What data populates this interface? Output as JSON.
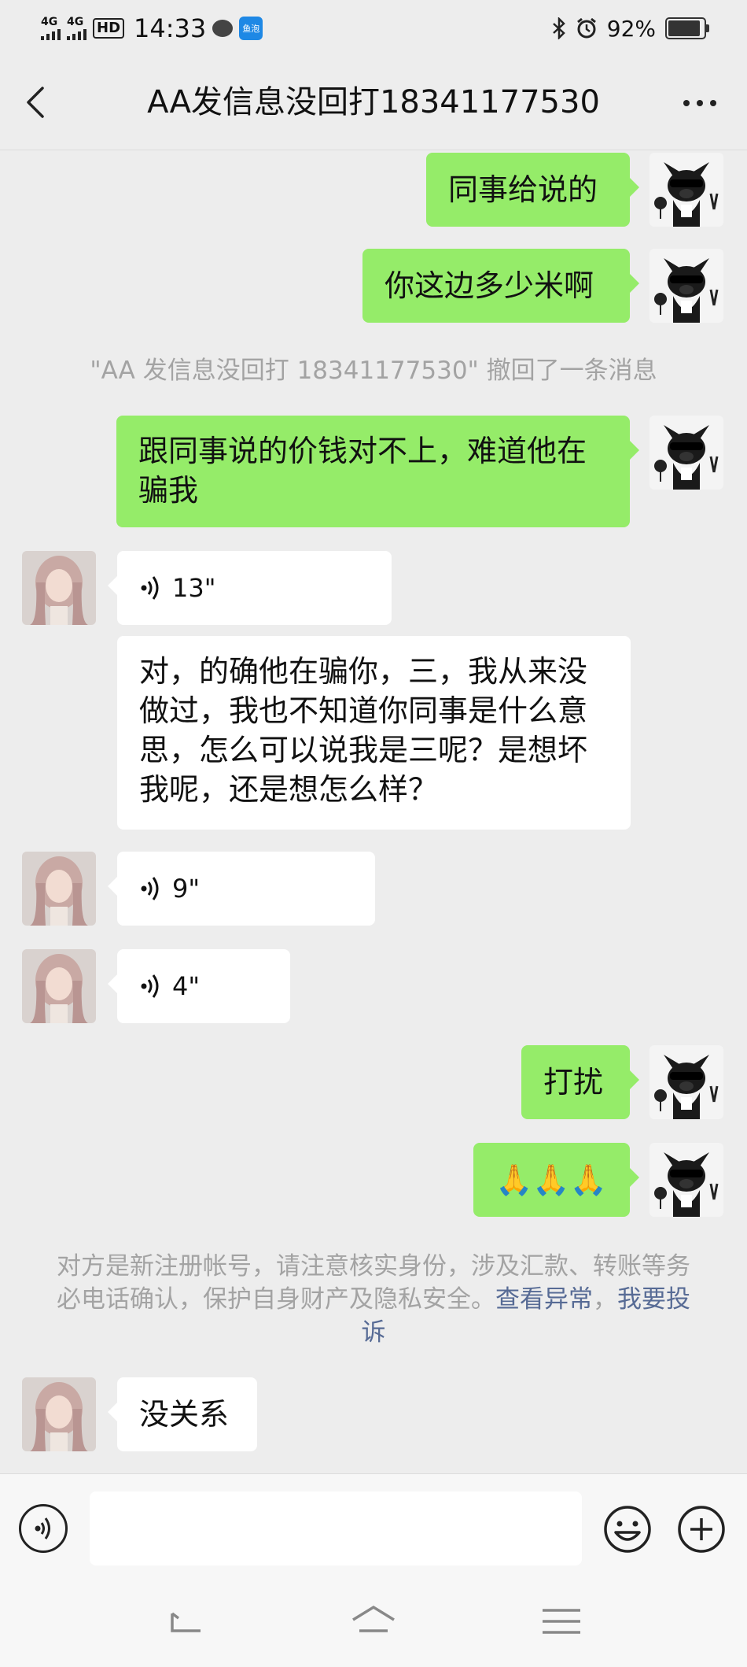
{
  "status_bar": {
    "network_1": "4G",
    "network_2": "4G",
    "hd": "HD",
    "time": "14:33",
    "app_label": "鱼泡",
    "battery_text": "92%",
    "battery_level": 0.92
  },
  "header": {
    "title": "AA发信息没回打18341177530"
  },
  "messages": {
    "m1": {
      "sender": "me",
      "text": "同事给说的"
    },
    "m2": {
      "sender": "me",
      "text": "你这边多少米啊"
    },
    "recall": "\"AA 发信息没回打 18341177530\" 撤回了一条消息",
    "m3": {
      "sender": "me",
      "text": "跟同事说的价钱对不上，难道他在骗我"
    },
    "m4": {
      "sender": "them",
      "type": "voice",
      "duration": "13\""
    },
    "m5": {
      "sender": "them",
      "text": "对，的确他在骗你，三，我从来没做过，我也不知道你同事是什么意思，怎么可以说我是三呢？是想坏我呢，还是想怎么样？"
    },
    "m6": {
      "sender": "them",
      "type": "voice",
      "duration": "9\""
    },
    "m7": {
      "sender": "them",
      "type": "voice",
      "duration": "4\""
    },
    "m8": {
      "sender": "me",
      "text": "打扰"
    },
    "m9": {
      "sender": "me",
      "text": "🙏🙏🙏"
    },
    "warning": {
      "text": "对方是新注册帐号，请注意核实身份，涉及汇款、转账等务必电话确认，保护自身财产及隐私安全。",
      "link1": "查看异常",
      "sep": "，",
      "link2": "我要投诉"
    },
    "m10": {
      "sender": "them",
      "text": "没关系"
    }
  },
  "input_bar": {
    "placeholder": ""
  },
  "icons": {
    "back": "chevron-left-icon",
    "more": "more-dots-icon",
    "voice": "voice-icon",
    "emoji": "emoji-icon",
    "plus": "plus-icon",
    "nav_back": "nav-back-icon",
    "nav_home": "nav-home-icon",
    "nav_menu": "nav-menu-icon"
  },
  "colors": {
    "my_bubble": "#95ec69",
    "their_bubble": "#ffffff",
    "link": "#576b95",
    "background": "#ededed"
  }
}
